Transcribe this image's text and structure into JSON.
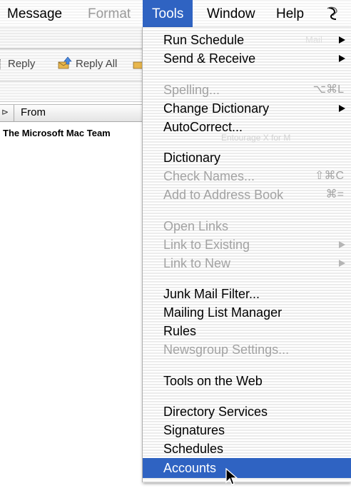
{
  "menubar": {
    "items": [
      {
        "label": "Message",
        "disabled": false
      },
      {
        "label": "Format",
        "disabled": true
      },
      {
        "label": "Tools",
        "active": true
      },
      {
        "label": "Window",
        "disabled": false
      },
      {
        "label": "Help",
        "disabled": false
      }
    ],
    "script_icon": "script-menu-icon"
  },
  "window": {
    "toolbar": {
      "reply_label": "Reply",
      "reply_all_label": "Reply All"
    },
    "column_header": {
      "from_label": "From"
    },
    "message_list": [
      {
        "from": "The Microsoft Mac Team"
      }
    ],
    "obscured_text": "Mail",
    "obscured_text_2": "Entourage X for M"
  },
  "tools_menu": {
    "items": [
      {
        "label": "Run Schedule",
        "submenu": true,
        "enabled": true
      },
      {
        "label": "Send & Receive",
        "submenu": true,
        "enabled": true
      },
      {
        "label": "Spelling...",
        "shortcut": "⌥⌘L",
        "enabled": false
      },
      {
        "label": "Change Dictionary",
        "submenu": true,
        "enabled": true
      },
      {
        "label": "AutoCorrect...",
        "enabled": true
      },
      {
        "label": "Dictionary",
        "enabled": true
      },
      {
        "label": "Check Names...",
        "shortcut": "⇧⌘C",
        "enabled": false
      },
      {
        "label": "Add to Address Book",
        "shortcut": "⌘=",
        "enabled": false
      },
      {
        "label": "Open Links",
        "enabled": false
      },
      {
        "label": "Link to Existing",
        "submenu": true,
        "enabled": false
      },
      {
        "label": "Link to New",
        "submenu": true,
        "enabled": false
      },
      {
        "label": "Junk Mail Filter...",
        "enabled": true
      },
      {
        "label": "Mailing List Manager",
        "enabled": true
      },
      {
        "label": "Rules",
        "enabled": true
      },
      {
        "label": "Newsgroup Settings...",
        "enabled": false
      },
      {
        "label": "Tools on the Web",
        "enabled": true
      },
      {
        "label": "Directory Services",
        "enabled": true
      },
      {
        "label": "Signatures",
        "enabled": true
      },
      {
        "label": "Schedules",
        "enabled": true
      },
      {
        "label": "Accounts",
        "enabled": true,
        "highlighted": true
      }
    ]
  },
  "colors": {
    "highlight": "#2f63c2",
    "disabled_text": "#a3a3a3"
  }
}
